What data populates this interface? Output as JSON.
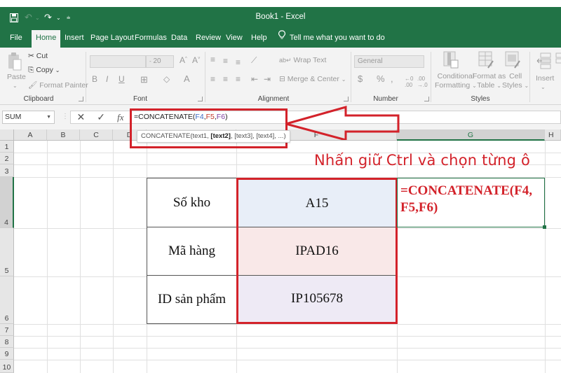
{
  "app": {
    "window_title": "Book1  -  Excel"
  },
  "quick_access": {
    "save_icon": "save-icon",
    "undo_icon": "undo-icon",
    "redo_icon": "redo-icon",
    "customize_icon": "customize-qat-icon"
  },
  "tabs": [
    {
      "label": "File"
    },
    {
      "label": "Home",
      "active": true
    },
    {
      "label": "Insert"
    },
    {
      "label": "Page Layout"
    },
    {
      "label": "Formulas"
    },
    {
      "label": "Data"
    },
    {
      "label": "Review"
    },
    {
      "label": "View"
    },
    {
      "label": "Help"
    }
  ],
  "tell_me": "Tell me what you want to do",
  "ribbon": {
    "clipboard": {
      "label": "Clipboard",
      "paste": "Paste",
      "cut": "Cut",
      "copy": "Copy",
      "format_painter": "Format Painter"
    },
    "font": {
      "label": "Font",
      "font_name": "",
      "font_size": "20",
      "bold": "B",
      "italic": "I",
      "underline": "U",
      "grow": "A",
      "shrink": "A",
      "font_color": "A"
    },
    "alignment": {
      "label": "Alignment",
      "wrap_text": "Wrap Text",
      "merge_center": "Merge & Center"
    },
    "number": {
      "label": "Number",
      "format": "General",
      "currency": "$",
      "percent": "%",
      "comma": ","
    },
    "styles": {
      "label": "Styles",
      "conditional_formatting": [
        "Conditional",
        "Formatting"
      ],
      "format_as_table": [
        "Format as",
        "Table"
      ],
      "cell_styles": [
        "Cell",
        "Styles"
      ]
    },
    "cells": {
      "insert": "Insert"
    }
  },
  "formula_bar": {
    "name_box": "SUM",
    "cancel": "✕",
    "enter": "✓",
    "fx": "fx",
    "formula_prefix": "=CONCATENATE(",
    "ref1": "F4",
    "sep1": ",",
    "ref2": "F5",
    "sep2": ",",
    "ref3": "F6",
    "formula_suffix": ")",
    "tooltip_prefix": "CONCATENATE(text1, ",
    "tooltip_bold": "[text2]",
    "tooltip_suffix": ", [text3], [text4], ...)"
  },
  "grid": {
    "columns": [
      "A",
      "B",
      "C",
      "D",
      "E",
      "F",
      "G",
      "H"
    ],
    "rows": [
      "1",
      "2",
      "3",
      "4",
      "5",
      "6",
      "7",
      "8",
      "9",
      "10"
    ],
    "selected_column": "G",
    "selected_row": "4"
  },
  "table": {
    "rows": [
      {
        "label": "Số kho",
        "value": "A15",
        "fill": "#e8eef8"
      },
      {
        "label": "Mã hàng",
        "value": "IPAD16",
        "fill": "#f9e8e8"
      },
      {
        "label": "ID sản phẩm",
        "value": "IP105678",
        "fill": "#eeeaf5"
      }
    ]
  },
  "result_cell": {
    "line1": "=CONCATENATE(F4,",
    "line2": "F5,F6)"
  },
  "annotation": {
    "hint": "Nhấn giữ Ctrl và chọn từng ô",
    "color": "#d3222a"
  },
  "colors": {
    "excel_green": "#217346",
    "ribbon_bg": "#f3f3f3"
  }
}
